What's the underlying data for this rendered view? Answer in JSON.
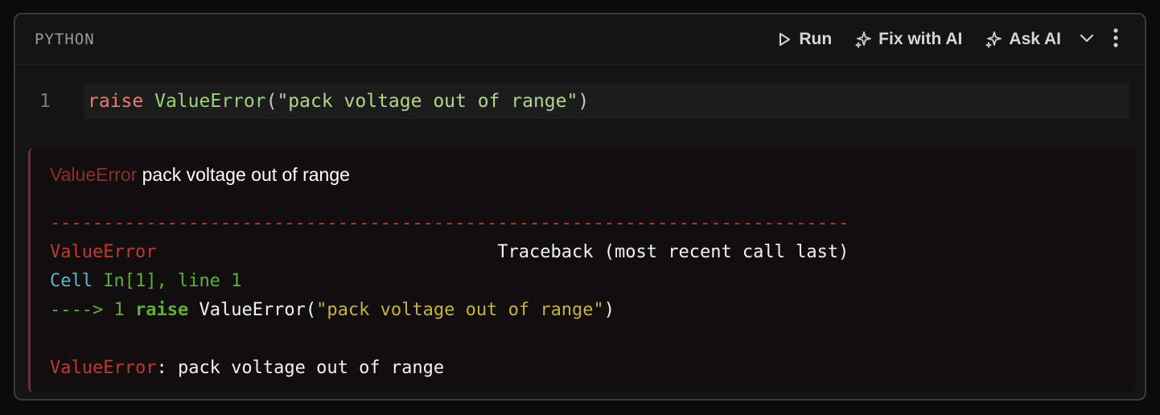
{
  "cell": {
    "language": "PYTHON",
    "toolbar": {
      "run_label": "Run",
      "fix_label": "Fix with AI",
      "ask_label": "Ask AI",
      "run_icon": "play-icon",
      "fix_icon": "sparkle-icon",
      "ask_icon": "sparkle-icon",
      "collapse_icon": "chevron-down-icon",
      "more_icon": "kebab-menu-icon"
    },
    "editor": {
      "line_number": "1",
      "code": {
        "keyword": "raise",
        "function": "ValueError",
        "open_paren": "(",
        "string": "\"pack voltage out of range\"",
        "close_paren": ")"
      }
    }
  },
  "output": {
    "summary": {
      "error_name": "ValueError",
      "message": "pack voltage out of range"
    },
    "traceback": {
      "separator": "---------------------------------------------------------------------------",
      "header_error": "ValueError",
      "header_spacer": "                                ",
      "header_text": "Traceback (most recent call last)",
      "cell_label": "Cell",
      "cell_ref": "In[1], line 1",
      "arrow": "---->",
      "line_no": "1",
      "keyword": "raise",
      "func": "ValueError(",
      "string": "\"pack voltage out of range\"",
      "close": ")",
      "final_error": "ValueError",
      "final_colon": ":",
      "final_message": " pack voltage out of range"
    }
  },
  "colors": {
    "error_red": "#c0392b",
    "keyword": "#f07a6f",
    "function": "#9ed07a"
  }
}
